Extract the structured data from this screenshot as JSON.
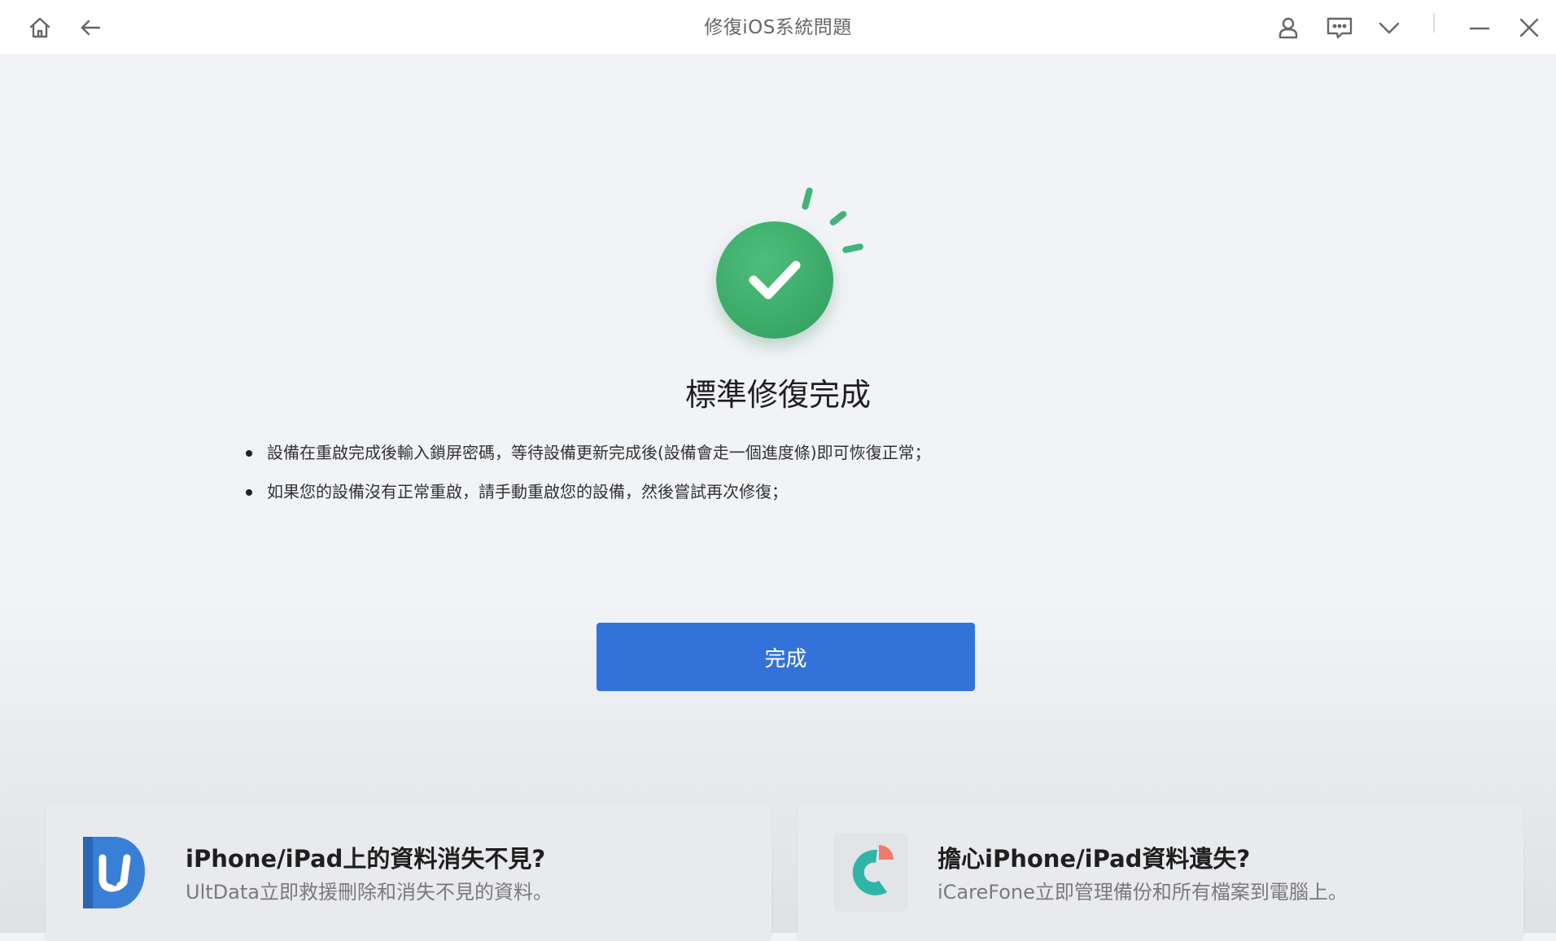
{
  "window": {
    "title": "修復iOS系統問題"
  },
  "titlebar_icons": [
    "home-icon",
    "back-arrow-icon",
    "user-icon",
    "feedback-icon",
    "chevron-down-icon",
    "minimize-icon",
    "close-icon"
  ],
  "result": {
    "title": "標準修復完成",
    "tips": [
      "設備在重啟完成後輸入鎖屏密碼，等待設備更新完成後(設備會走一個進度條)即可恢復正常；",
      "如果您的設備沒有正常重啟，請手動重啟您的設備，然後嘗試再次修復；"
    ]
  },
  "done_button": {
    "label": "完成"
  },
  "promos": [
    {
      "title": "iPhone/iPad上的資料消失不見?",
      "subtitle": "UltData立即救援刪除和消失不見的資料。",
      "icon": "ultdata-logo-icon"
    },
    {
      "title": "擔心iPhone/iPad資料遺失?",
      "subtitle": "iCareFone立即管理備份和所有檔案到電腦上。",
      "icon": "icarefone-logo-icon"
    }
  ],
  "colors": {
    "accent": "#3372d9",
    "success": "#2f9e5e"
  }
}
